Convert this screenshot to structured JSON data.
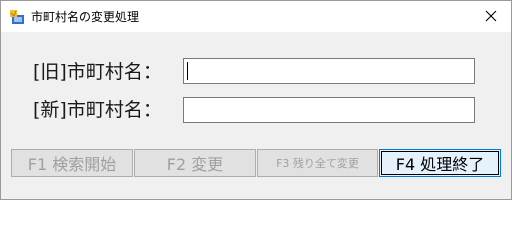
{
  "window": {
    "title": "市町村名の変更処理",
    "close_glyph": "✕"
  },
  "form": {
    "old_label": "[旧]市町村名：",
    "old_value": "",
    "new_label": "[新]市町村名：",
    "new_value": ""
  },
  "buttons": {
    "f1": "F1 検索開始",
    "f2": "F2 変更",
    "f3": "F3 残り全て変更",
    "f4": "F4 処理終了"
  },
  "colors": {
    "window_bg": "#f0f0f0",
    "title_bg": "#ffffff",
    "disabled_text": "#a0a0a0",
    "focus_border": "#0078d7"
  }
}
